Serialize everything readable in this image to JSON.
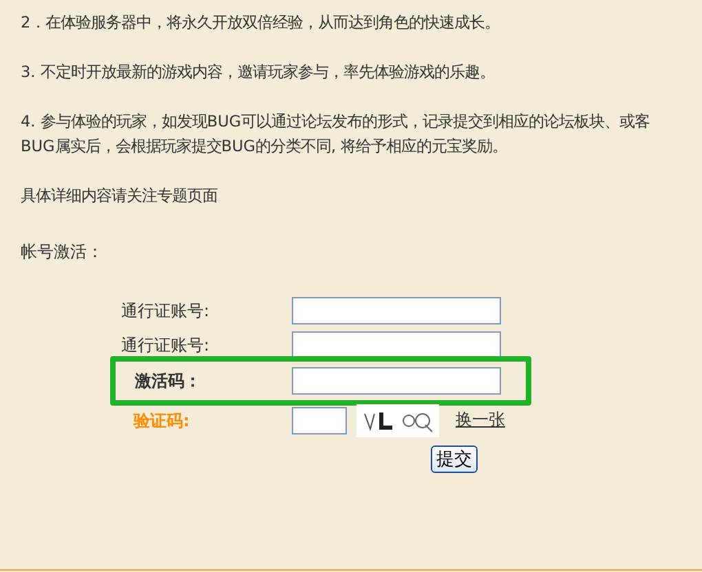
{
  "paragraphs": [
    {
      "lines": [
        "2．在体验服务器中，将永久开放双倍经验，从而达到角色的快速成长。"
      ]
    },
    {
      "lines": [
        "3. 不定时开放最新的游戏内容，邀请玩家参与，率先体验游戏的乐趣。"
      ]
    },
    {
      "lines": [
        "4. 参与体验的玩家，如发现BUG可以通过论坛发布的形式，记录提交到相应的论坛板块、或客",
        "BUG属实后，会根据玩家提交BUG的分类不同, 将给予相应的元宝奖励。"
      ]
    },
    {
      "lines": [
        "具体详细内容请关注专题页面"
      ]
    }
  ],
  "section_title": "帐号激活：",
  "fields": [
    {
      "label": "通行证账号:",
      "kind": "plain",
      "highlighted": false
    },
    {
      "label": "通行证账号:",
      "kind": "plain",
      "highlighted": false
    },
    {
      "label": "激活码：",
      "kind": "strong",
      "highlighted": true
    }
  ],
  "captcha": {
    "label": "验证码:",
    "link": "换一张",
    "kind": "picture"
  },
  "submit": "提交"
}
